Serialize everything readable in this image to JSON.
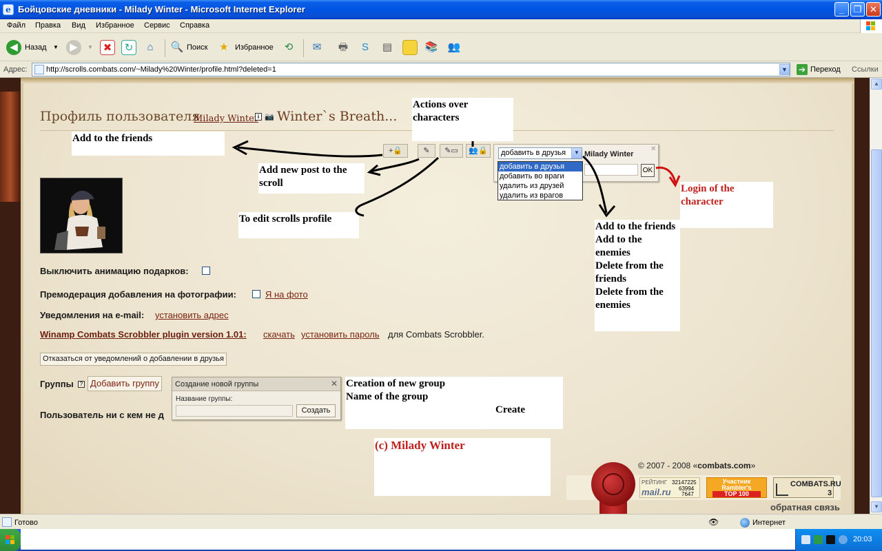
{
  "window": {
    "title": "Бойцовские дневники - Milady Winter - Microsoft Internet Explorer",
    "icon": "ie-icon"
  },
  "menu": [
    "Файл",
    "Правка",
    "Вид",
    "Избранное",
    "Сервис",
    "Справка"
  ],
  "toolbar": {
    "back_label": "Назад",
    "search_label": "Поиск",
    "favorites_label": "Избранное"
  },
  "address": {
    "label": "Адрес:",
    "value": "http://scrolls.combats.com/~Milady%20Winter/profile.html?deleted=1",
    "go_label": "Переход",
    "links_label": "Ссылки"
  },
  "page": {
    "title_prefix": "Профиль пользователя",
    "user": "Milady Winter",
    "scroll_name": "Winter`s Breath...",
    "options": {
      "disable_gift_animation": "Выключить анимацию подарков:",
      "photo_premoderation": "Премодерация добавления на фотографии:",
      "me_on_photo_link": "Я на фото",
      "email_notifications": "Уведомления на e-mail:",
      "set_address_link": "установить адрес",
      "winamp_title": "Winamp Combats Scrobbler plugin version 1.01:",
      "download_link": "скачать",
      "set_password_link": "установить пароль",
      "winamp_suffix": "для Combats Scrobbler.",
      "decline_friend_notifications": "Отказаться от уведомлений о добавлении в друзья"
    },
    "groups": {
      "label": "Группы",
      "help": "?",
      "add_group": "Добавить группу",
      "nobody_text": "Пользователь ни с кем не д",
      "panel_title": "Создание новой группы",
      "name_label": "Название группы:",
      "create_button": "Создать"
    },
    "friend_popup": {
      "selected": "добавить в друзья",
      "login": "Milady Winter",
      "ok": "OK",
      "options": [
        "добавить в друзья",
        "добавить во враги",
        "удалить из друзей",
        "удалить из врагов"
      ]
    },
    "action_buttons": [
      "+",
      "✎",
      "✎",
      "👥"
    ],
    "footer": {
      "copyright_prefix": "© 2007 - 2008 «",
      "copyright_site": "combats.com",
      "copyright_suffix": "»",
      "feedback": "обратная связь",
      "mail_rating": "РЕЙТИНГ",
      "mail_logo": "mail.ru",
      "mail_n1": "32147225",
      "mail_n2": "63994",
      "mail_n3": "7647",
      "rambler_line1": "Участник",
      "rambler_line2": "Rambler's",
      "rambler_line3": "TOP 100",
      "combats_logo": "COMBATS.RU",
      "combats_num": "3"
    }
  },
  "annotations": {
    "actions_over_characters": "Actions over characters",
    "add_to_friends": "Add to the friends",
    "add_new_post": "Add new post to the scroll",
    "edit_scrolls_profile": "To edit scrolls profile",
    "login_of_character": "Login of the character",
    "option_list": "Add to the friends\nAdd to the enemies\nDelete from the friends\nDelete from the enemies",
    "creation_group": "Creation of new group\nName of the group",
    "create": "Create",
    "copyright_note": "(c) Milady Winter"
  },
  "statusbar": {
    "text": "Готово",
    "zone": "Интернет"
  },
  "taskbar": {
    "clock": "20:03"
  },
  "colors": {
    "titlebar": "#0054e3",
    "parchment": "#efe7d4",
    "link": "#7a2412",
    "annotation_red": "#c0201c",
    "arrow": "#000000",
    "arrow_red": "#d01010"
  }
}
